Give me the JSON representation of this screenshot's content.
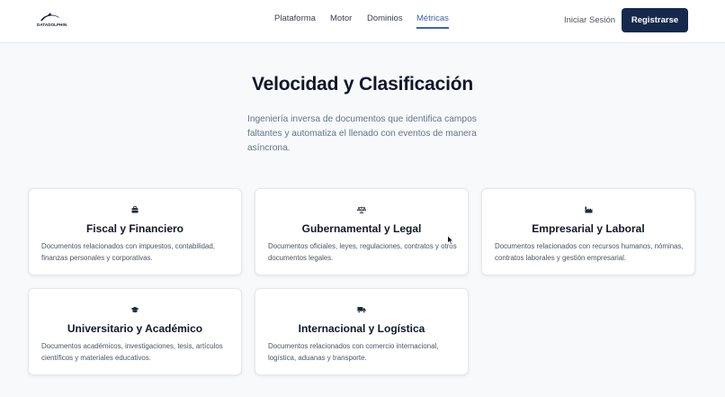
{
  "brand": {
    "name": "DATADOLPHIN"
  },
  "nav": {
    "items": [
      "Plataforma",
      "Motor",
      "Dominios",
      "Métricas"
    ],
    "active": "Métricas"
  },
  "header_actions": {
    "login": "Iniciar Sesión",
    "register": "Registrarse"
  },
  "hero": {
    "title": "Velocidad y Clasificación",
    "description": "Ingeniería inversa de documentos que identifica campos faltantes y automatiza el llenado con eventos de manera asíncrona."
  },
  "cards": [
    {
      "icon": "briefcase-icon",
      "title": "Fiscal y Financiero",
      "description": "Documentos relacionados con impuestos, contabilidad, finanzas personales y corporativas."
    },
    {
      "icon": "scale-icon",
      "title": "Gubernamental y Legal",
      "description": "Documentos oficiales, leyes, regulaciones, contratos y otros documentos legales."
    },
    {
      "icon": "factory-icon",
      "title": "Empresarial y Laboral",
      "description": "Documentos relacionados con recursos humanos, nóminas, contratos laborales y gestión empresarial."
    },
    {
      "icon": "graduation-cap-icon",
      "title": "Universitario y Académico",
      "description": "Documentos académicos, investigaciones, tesis, artículos científicos y materiales educativos."
    },
    {
      "icon": "truck-icon",
      "title": "Internacional y Logística",
      "description": "Documentos relacionados con comercio internacional, logística, aduanas y transporte."
    }
  ],
  "colors": {
    "primary": "#15294d",
    "accent": "#3b63b8",
    "background": "#f8f9fb"
  }
}
